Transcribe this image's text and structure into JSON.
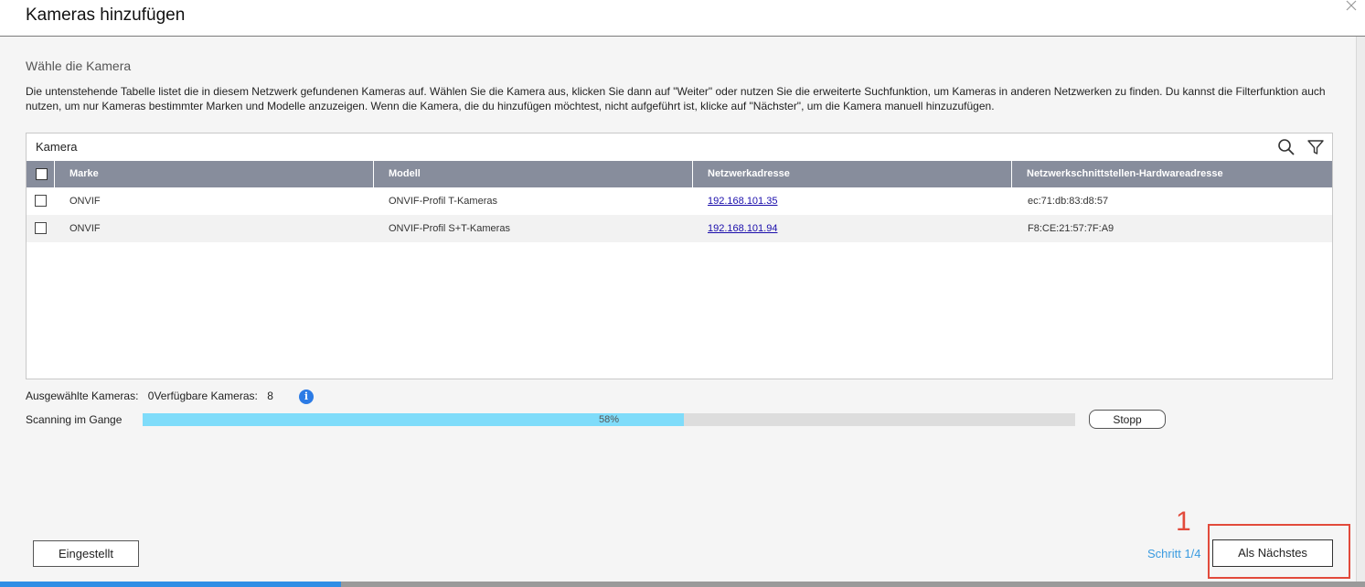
{
  "dialog": {
    "title": "Kameras hinzufügen"
  },
  "section": {
    "heading": "Wähle die Kamera",
    "description": "Die untenstehende Tabelle listet die in diesem Netzwerk gefundenen Kameras auf. Wählen Sie die Kamera aus, klicken Sie dann auf \"Weiter\" oder nutzen Sie die erweiterte Suchfunktion, um Kameras in anderen Netzwerken zu finden. Du kannst die Filterfunktion auch nutzen, um nur Kameras bestimmter Marken und Modelle anzuzeigen. Wenn die Kamera, die du hinzufügen möchtest, nicht aufgeführt ist, klicke auf \"Nächster\", um die Kamera manuell hinzuzufügen."
  },
  "table": {
    "panel_title": "Kamera",
    "icons": [
      "search-icon",
      "filter-icon"
    ],
    "columns": [
      "Marke",
      "Modell",
      "Netzwerkadresse",
      "Netzwerkschnittstellen-Hardwareadresse"
    ],
    "rows": [
      {
        "brand": "ONVIF",
        "model": "ONVIF-Profil T-Kameras",
        "address": "192.168.101.35",
        "mac": "ec:71:db:83:d8:57"
      },
      {
        "brand": "ONVIF",
        "model": "ONVIF-Profil S+T-Kameras",
        "address": "192.168.101.94",
        "mac": "F8:CE:21:57:7F:A9"
      }
    ]
  },
  "stats": {
    "selected_label": "Ausgewählte Kameras:",
    "selected_value": "0",
    "available_label": "Verfügbare Kameras:",
    "available_value": "8"
  },
  "scan": {
    "label": "Scanning im Gange",
    "progress_text": "58%",
    "progress_percent": 58,
    "stop_label": "Stopp"
  },
  "footer": {
    "settings_label": "Eingestellt",
    "step_label": "Schritt 1/4",
    "next_label": "Als Nächstes",
    "step_progress_fraction": 0.25,
    "annotation_number": "1"
  },
  "colors": {
    "header_bg": "#878d9c",
    "progress_fill": "#7fdcfa",
    "accent_blue": "#2f8ee5",
    "annotation_red": "#e24a3b",
    "link": "#1a0dab"
  }
}
